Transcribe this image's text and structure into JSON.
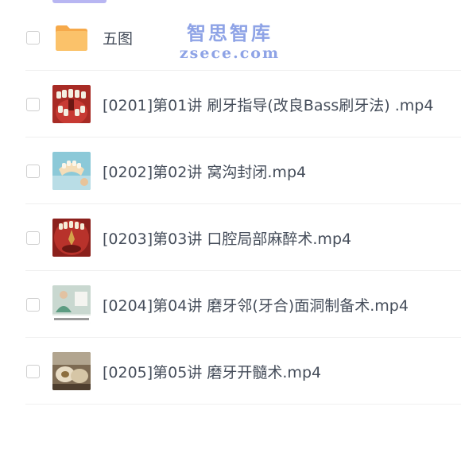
{
  "watermark": {
    "line1": "智思智库",
    "line2": "zsece.com"
  },
  "items": [
    {
      "name": "五图",
      "type": "folder",
      "icon": "folder-icon"
    },
    {
      "name": "[0201]第01讲 刷牙指导(改良Bass刷牙法) .mp4",
      "type": "video",
      "icon": "teeth-model-thumbnail"
    },
    {
      "name": "[0202]第02讲 窝沟封闭.mp4",
      "type": "video",
      "icon": "teeth-cast-thumbnail"
    },
    {
      "name": "[0203]第03讲 口腔局部麻醉术.mp4",
      "type": "video",
      "icon": "mouth-thumbnail"
    },
    {
      "name": "[0204]第04讲 磨牙邻(牙合)面洞制备术.mp4",
      "type": "video",
      "icon": "lecture-thumbnail"
    },
    {
      "name": "[0205]第05讲 磨牙开髓术.mp4",
      "type": "video",
      "icon": "tooth-closeup-thumbnail"
    }
  ],
  "colors": {
    "folder": "#fbc26a",
    "text": "#454d5a",
    "accent": "#b8b6f2",
    "watermark": "#8ea3e6"
  }
}
